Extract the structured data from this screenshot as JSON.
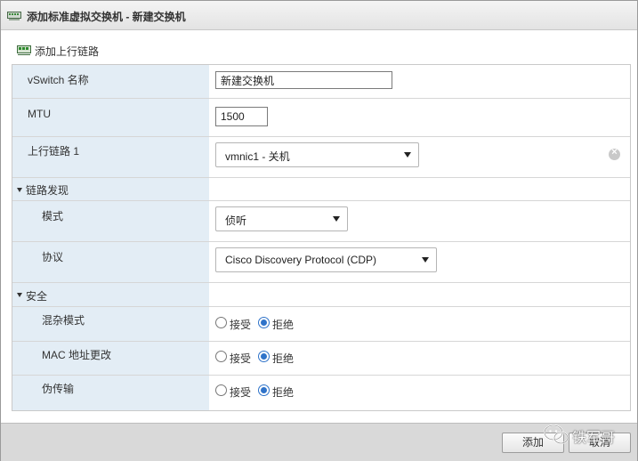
{
  "dialog": {
    "title": "添加标准虚拟交换机 - 新建交换机"
  },
  "toolbar": {
    "add_uplink_label": "添加上行链路"
  },
  "form": {
    "vswitch_name": {
      "label": "vSwitch 名称",
      "value": "新建交换机"
    },
    "mtu": {
      "label": "MTU",
      "value": "1500"
    },
    "uplink1": {
      "label": "上行链路 1",
      "value": "vmnic1 - 关机"
    },
    "link_discovery": {
      "label": "链路发现",
      "mode": {
        "label": "模式",
        "value": "侦听"
      },
      "protocol": {
        "label": "协议",
        "value": "Cisco Discovery Protocol (CDP)"
      }
    },
    "security": {
      "label": "安全",
      "promiscuous": {
        "label": "混杂模式",
        "accept": "接受",
        "reject": "拒绝",
        "selected": "reject"
      },
      "mac_change": {
        "label": "MAC 地址更改",
        "accept": "接受",
        "reject": "拒绝",
        "selected": "reject"
      },
      "forged_transmits": {
        "label": "伪传输",
        "accept": "接受",
        "reject": "拒绝",
        "selected": "reject"
      }
    }
  },
  "footer": {
    "add_label": "添加",
    "cancel_label": "取消"
  },
  "watermark": {
    "text": "铁军哥"
  },
  "icons": {
    "title": "virtual-switch-icon",
    "add_uplink": "network-adapter-add-icon",
    "clear": "clear-circle-icon",
    "collapse": "caret-down-icon",
    "watermark": "wechat-logo-icon"
  },
  "colors": {
    "label_bg": "#e3edf5",
    "radio_accent": "#2f73c9",
    "footer_bg": "#d9d9d9"
  }
}
